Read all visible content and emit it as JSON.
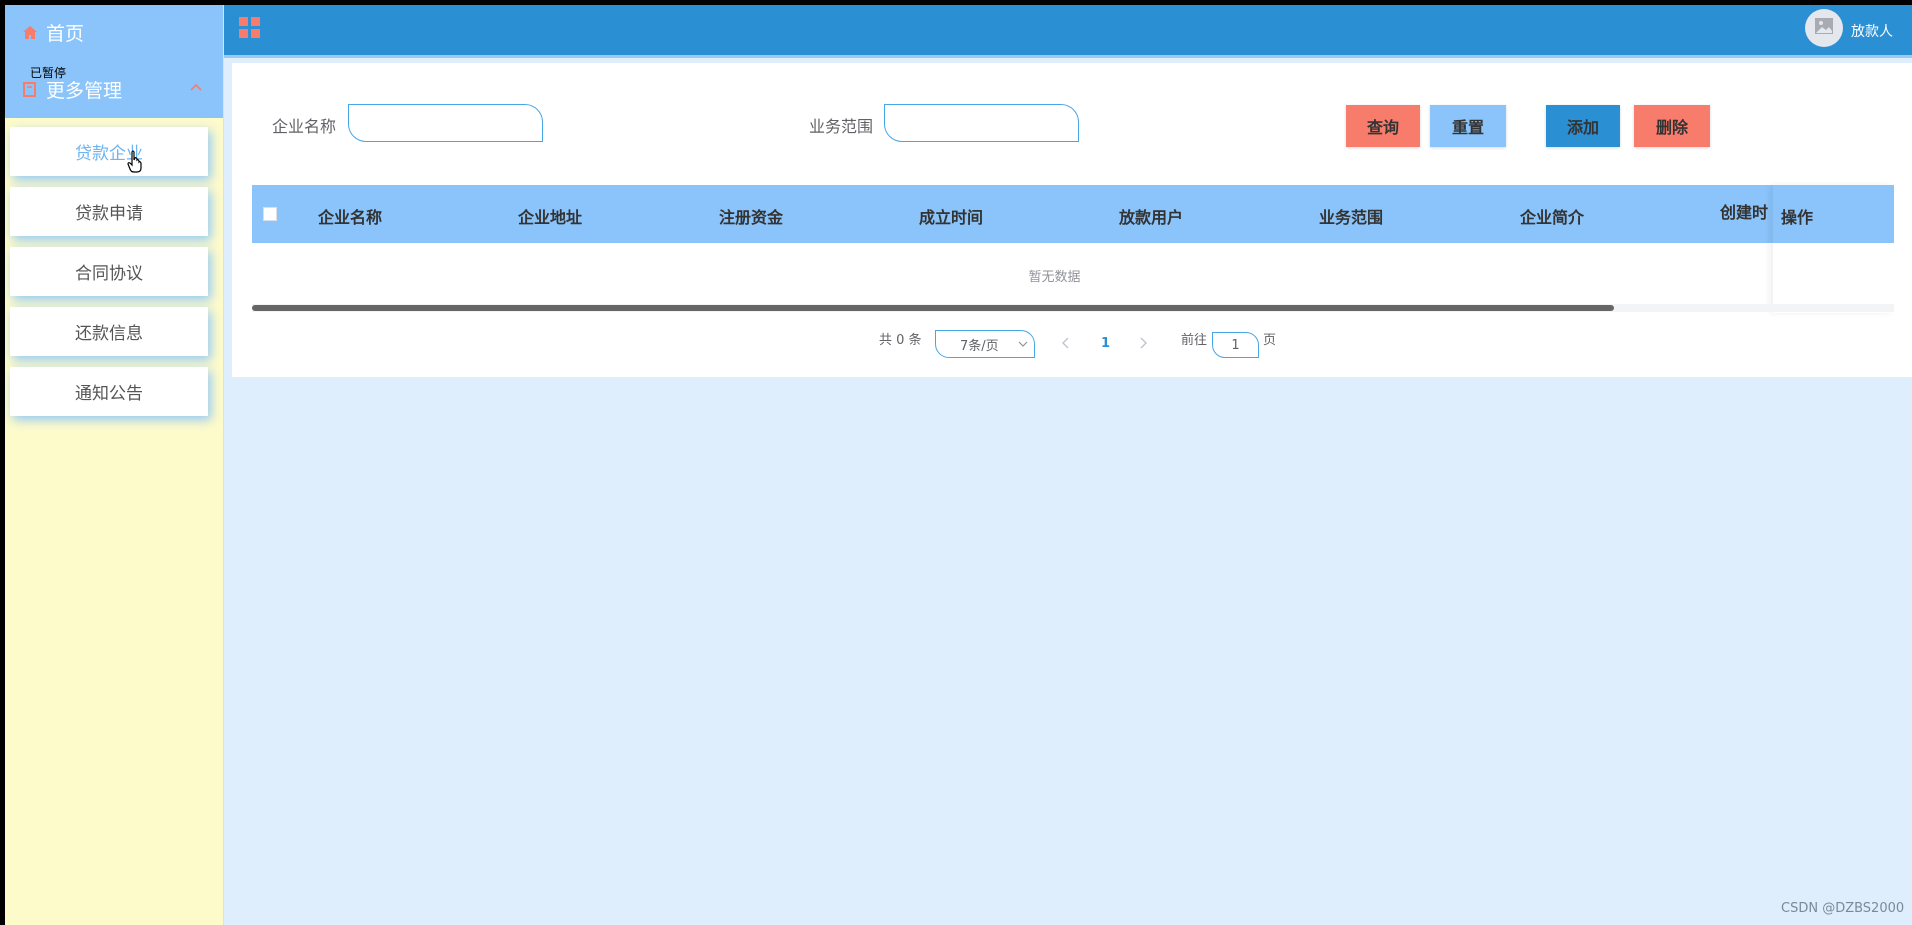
{
  "sidebar": {
    "home_label": "首页",
    "more_label": "更多管理",
    "paused_overlay": "已暂停",
    "items": [
      {
        "label": "贷款企业",
        "active": true
      },
      {
        "label": "贷款申请",
        "active": false
      },
      {
        "label": "合同协议",
        "active": false
      },
      {
        "label": "还款信息",
        "active": false
      },
      {
        "label": "通知公告",
        "active": false
      }
    ]
  },
  "topbar": {
    "username": "放款人",
    "grid_icon": "grid-icon",
    "avatar_icon": "image-icon"
  },
  "search": {
    "company_label": "企业名称",
    "company_value": "",
    "scope_label": "业务范围",
    "scope_value": "",
    "query_label": "查询",
    "reset_label": "重置",
    "add_label": "添加",
    "delete_label": "删除"
  },
  "table": {
    "columns": [
      "企业名称",
      "企业地址",
      "注册资金",
      "成立时间",
      "放款用户",
      "业务范围",
      "企业简介",
      "创建时"
    ],
    "action_column": "操作",
    "empty_text": "暂无数据"
  },
  "pagination": {
    "total_text": "共 0 条",
    "page_size": "7条/页",
    "current_page": "1",
    "goto_label": "前往",
    "goto_value": "1",
    "page_suffix": "页"
  },
  "watermark": "CSDN @DZBS2000",
  "colors": {
    "primary": "#2b8fd4",
    "light_blue": "#8ac4fb",
    "coral": "#f87c6b",
    "sidebar_bg": "#fefbcb",
    "page_bg": "#deeefc"
  }
}
